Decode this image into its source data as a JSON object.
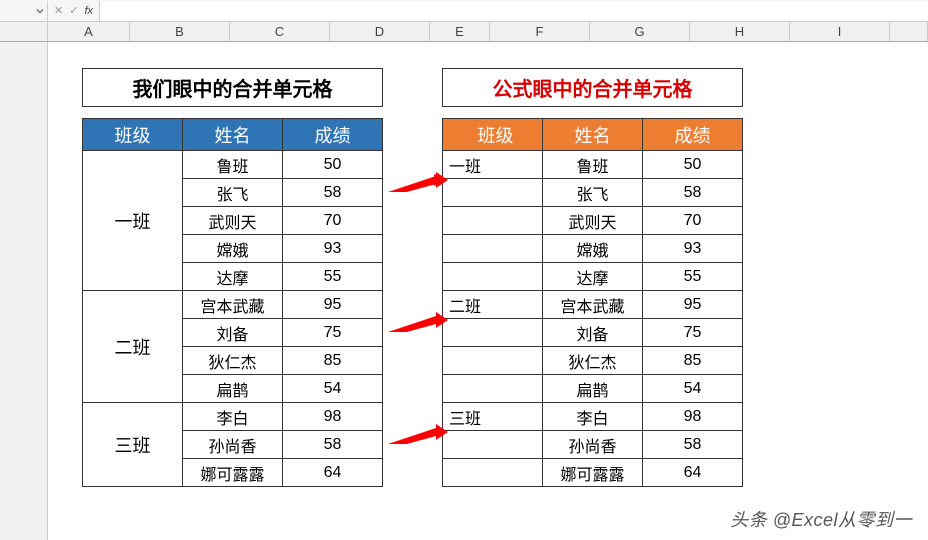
{
  "formula_bar": {
    "cancel_glyph": "✕",
    "confirm_glyph": "✓",
    "fx_label": "fx"
  },
  "columns": [
    "A",
    "B",
    "C",
    "D",
    "E",
    "F",
    "G",
    "H",
    "I"
  ],
  "left_table": {
    "title": "我们眼中的合并单元格",
    "headers": {
      "class": "班级",
      "name": "姓名",
      "score": "成绩"
    },
    "groups": [
      {
        "class": "一班",
        "rows": [
          {
            "name": "鲁班",
            "score": "50"
          },
          {
            "name": "张飞",
            "score": "58"
          },
          {
            "name": "武则天",
            "score": "70"
          },
          {
            "name": "嫦娥",
            "score": "93"
          },
          {
            "name": "达摩",
            "score": "55"
          }
        ]
      },
      {
        "class": "二班",
        "rows": [
          {
            "name": "宫本武藏",
            "score": "95"
          },
          {
            "name": "刘备",
            "score": "75"
          },
          {
            "name": "狄仁杰",
            "score": "85"
          },
          {
            "name": "扁鹊",
            "score": "54"
          }
        ]
      },
      {
        "class": "三班",
        "rows": [
          {
            "name": "李白",
            "score": "98"
          },
          {
            "name": "孙尚香",
            "score": "58"
          },
          {
            "name": "娜可露露",
            "score": "64"
          }
        ]
      }
    ]
  },
  "right_table": {
    "title": "公式眼中的合并单元格",
    "headers": {
      "class": "班级",
      "name": "姓名",
      "score": "成绩"
    },
    "rows": [
      {
        "class": "一班",
        "name": "鲁班",
        "score": "50"
      },
      {
        "class": "",
        "name": "张飞",
        "score": "58"
      },
      {
        "class": "",
        "name": "武则天",
        "score": "70"
      },
      {
        "class": "",
        "name": "嫦娥",
        "score": "93"
      },
      {
        "class": "",
        "name": "达摩",
        "score": "55"
      },
      {
        "class": "二班",
        "name": "宫本武藏",
        "score": "95"
      },
      {
        "class": "",
        "name": "刘备",
        "score": "75"
      },
      {
        "class": "",
        "name": "狄仁杰",
        "score": "85"
      },
      {
        "class": "",
        "name": "扁鹊",
        "score": "54"
      },
      {
        "class": "三班",
        "name": "李白",
        "score": "98"
      },
      {
        "class": "",
        "name": "孙尚香",
        "score": "58"
      },
      {
        "class": "",
        "name": "娜可露露",
        "score": "64"
      }
    ]
  },
  "watermark": "头条 @Excel从零到一",
  "chart_data": {
    "type": "table",
    "title": "合并单元格对比",
    "series": [
      {
        "name": "我们眼中的合并单元格",
        "columns": [
          "班级",
          "姓名",
          "成绩"
        ],
        "rows": [
          [
            "一班",
            "鲁班",
            50
          ],
          [
            "一班",
            "张飞",
            58
          ],
          [
            "一班",
            "武则天",
            70
          ],
          [
            "一班",
            "嫦娥",
            93
          ],
          [
            "一班",
            "达摩",
            55
          ],
          [
            "二班",
            "宫本武藏",
            95
          ],
          [
            "二班",
            "刘备",
            75
          ],
          [
            "二班",
            "狄仁杰",
            85
          ],
          [
            "二班",
            "扁鹊",
            54
          ],
          [
            "三班",
            "李白",
            98
          ],
          [
            "三班",
            "孙尚香",
            58
          ],
          [
            "三班",
            "娜可露露",
            64
          ]
        ]
      },
      {
        "name": "公式眼中的合并单元格",
        "columns": [
          "班级",
          "姓名",
          "成绩"
        ],
        "rows": [
          [
            "一班",
            "鲁班",
            50
          ],
          [
            "",
            "张飞",
            58
          ],
          [
            "",
            "武则天",
            70
          ],
          [
            "",
            "嫦娥",
            93
          ],
          [
            "",
            "达摩",
            55
          ],
          [
            "二班",
            "宫本武藏",
            95
          ],
          [
            "",
            "刘备",
            75
          ],
          [
            "",
            "狄仁杰",
            85
          ],
          [
            "",
            "扁鹊",
            54
          ],
          [
            "三班",
            "李白",
            98
          ],
          [
            "",
            "孙尚香",
            58
          ],
          [
            "",
            "娜可露露",
            64
          ]
        ]
      }
    ]
  }
}
